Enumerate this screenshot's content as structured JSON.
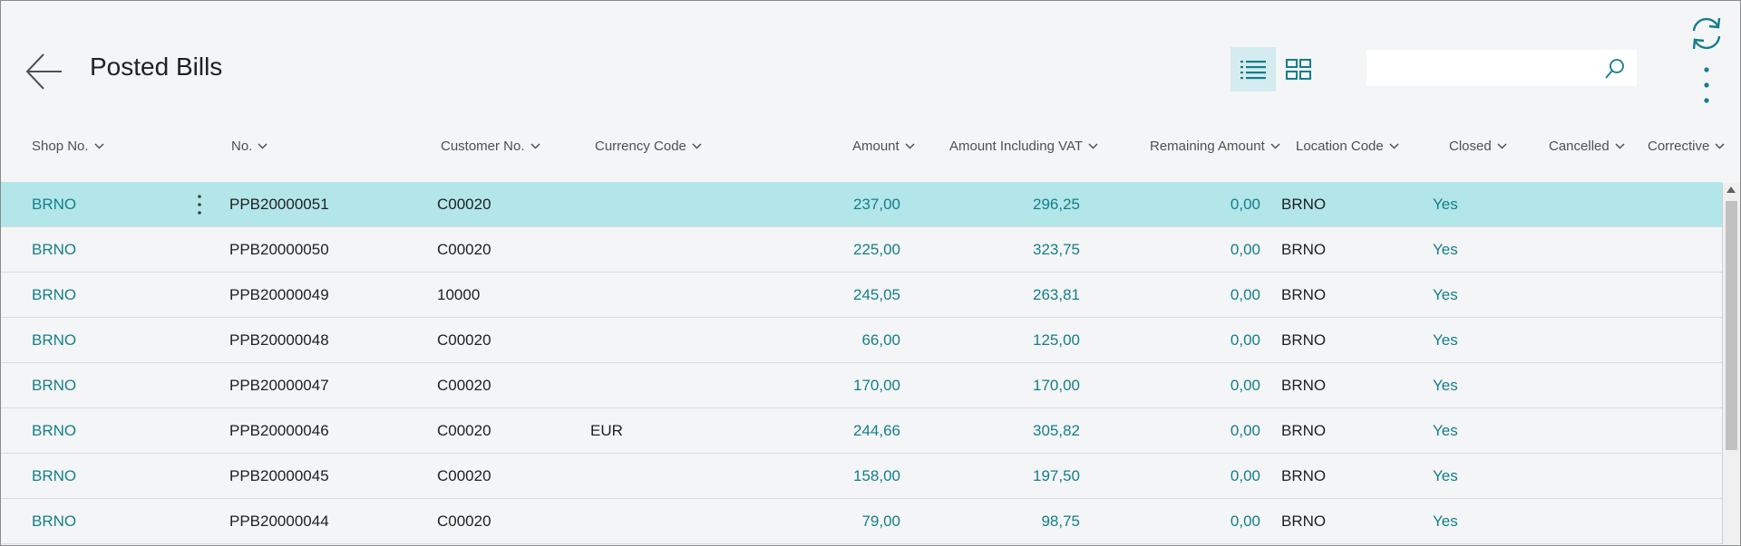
{
  "header": {
    "title": "Posted Bills",
    "search": {
      "value": "",
      "placeholder": ""
    }
  },
  "icons": {
    "back": "arrow-left-icon",
    "list_view": "list-view-icon",
    "tile_view": "tile-view-icon",
    "search": "search-icon",
    "refresh": "refresh-icon",
    "more": "more-vertical-icon"
  },
  "colors": {
    "accent": "#147e8a",
    "selected_row": "#b2e6e9",
    "active_view": "#d4ecef",
    "background": "#f4f5f6"
  },
  "columns": [
    "Shop No.",
    "No.",
    "Customer No.",
    "Currency Code",
    "Amount",
    "Amount Including VAT",
    "Remaining Amount",
    "Location Code",
    "Closed",
    "Cancelled",
    "Corrective"
  ],
  "rows": [
    {
      "shop": "BRNO",
      "no": "PPB20000051",
      "customer": "C00020",
      "currency": "",
      "amount": "237,00",
      "amount_vat": "296,25",
      "remaining": "0,00",
      "location": "BRNO",
      "closed": "Yes",
      "cancelled": "",
      "corrective": ""
    },
    {
      "shop": "BRNO",
      "no": "PPB20000050",
      "customer": "C00020",
      "currency": "",
      "amount": "225,00",
      "amount_vat": "323,75",
      "remaining": "0,00",
      "location": "BRNO",
      "closed": "Yes",
      "cancelled": "",
      "corrective": ""
    },
    {
      "shop": "BRNO",
      "no": "PPB20000049",
      "customer": "10000",
      "currency": "",
      "amount": "245,05",
      "amount_vat": "263,81",
      "remaining": "0,00",
      "location": "BRNO",
      "closed": "Yes",
      "cancelled": "",
      "corrective": ""
    },
    {
      "shop": "BRNO",
      "no": "PPB20000048",
      "customer": "C00020",
      "currency": "",
      "amount": "66,00",
      "amount_vat": "125,00",
      "remaining": "0,00",
      "location": "BRNO",
      "closed": "Yes",
      "cancelled": "",
      "corrective": ""
    },
    {
      "shop": "BRNO",
      "no": "PPB20000047",
      "customer": "C00020",
      "currency": "",
      "amount": "170,00",
      "amount_vat": "170,00",
      "remaining": "0,00",
      "location": "BRNO",
      "closed": "Yes",
      "cancelled": "",
      "corrective": ""
    },
    {
      "shop": "BRNO",
      "no": "PPB20000046",
      "customer": "C00020",
      "currency": "EUR",
      "amount": "244,66",
      "amount_vat": "305,82",
      "remaining": "0,00",
      "location": "BRNO",
      "closed": "Yes",
      "cancelled": "",
      "corrective": ""
    },
    {
      "shop": "BRNO",
      "no": "PPB20000045",
      "customer": "C00020",
      "currency": "",
      "amount": "158,00",
      "amount_vat": "197,50",
      "remaining": "0,00",
      "location": "BRNO",
      "closed": "Yes",
      "cancelled": "",
      "corrective": ""
    },
    {
      "shop": "BRNO",
      "no": "PPB20000044",
      "customer": "C00020",
      "currency": "",
      "amount": "79,00",
      "amount_vat": "98,75",
      "remaining": "0,00",
      "location": "BRNO",
      "closed": "Yes",
      "cancelled": "",
      "corrective": ""
    }
  ]
}
